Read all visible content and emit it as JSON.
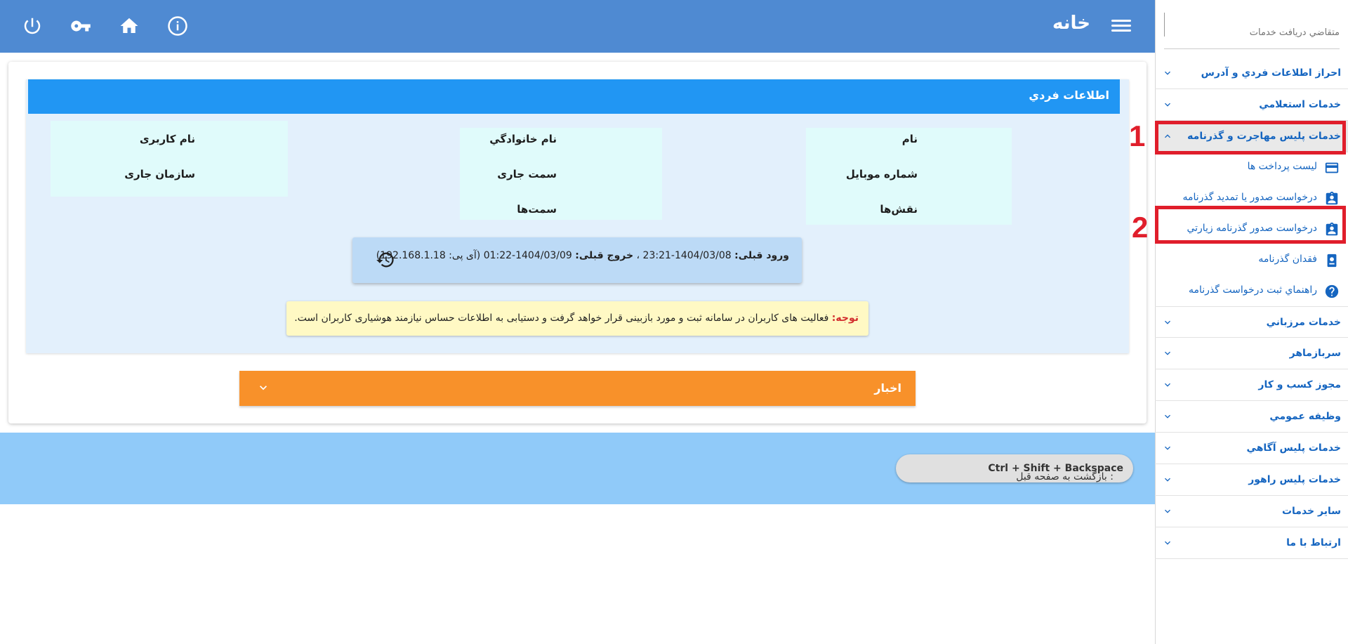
{
  "header": {
    "title": "خانه"
  },
  "personal_info": {
    "title": "اطلاعات فردي",
    "labels": {
      "name": "نام",
      "family": "نام خانوادگي",
      "username": "نام کاربری",
      "mobile": "شماره موبايل",
      "position": "سمت جاری",
      "organization": "سازمان جاری",
      "roles": "نقش‌ها",
      "positions": "سمت‌ها"
    }
  },
  "login": {
    "prev_login_label": "ورود قبلی:",
    "prev_login_value": "1404/03/08-23:21",
    "sep": "،",
    "prev_logout_label": "خروج قبلی:",
    "prev_logout_value": "1404/03/09-01:22",
    "ip_text": "(آی پی: 192.168.1.18)"
  },
  "notice": {
    "warn": "توجه:",
    "text": "فعالیت های کاربران در سامانه ثبت و مورد بازبینی قرار خواهد گرفت و دستیابی به اطلاعات حساس نیازمند هوشیاری کاربران است."
  },
  "news": {
    "label": "اخبار"
  },
  "footer": {
    "shortcut": "Ctrl + Shift + Backspace",
    "shortcut_desc": ": بازگشت به صفحه قبل"
  },
  "sidebar": {
    "search_placeholder": "متقاضي دريافت خدمات",
    "items": [
      {
        "label": "احراز اطلاعات فردي و آدرس"
      },
      {
        "label": "خدمات استعلامي"
      },
      {
        "label": "خدمات پليس مهاجرت و گذرنامه"
      },
      {
        "label": "خدمات مرزباني"
      },
      {
        "label": "سربازماهر"
      },
      {
        "label": "مجوز کسب و کار"
      },
      {
        "label": "وظيفه عمومي"
      },
      {
        "label": "خدمات پليس آگاهي"
      },
      {
        "label": "خدمات پليس راهور"
      },
      {
        "label": "ساير خدمات"
      },
      {
        "label": "ارتباط با ما"
      }
    ],
    "subitems": [
      {
        "label": "ليست پرداخت ها",
        "icon": "credit-card-icon"
      },
      {
        "label": "درخواست صدور يا تمديد گذرنامه",
        "icon": "id-badge-icon"
      },
      {
        "label": "درخواست صدور گذرنامه زيارتي",
        "icon": "id-badge-icon"
      },
      {
        "label": "فقدان گذرنامه",
        "icon": "lost-passport-icon"
      },
      {
        "label": "راهنماي ثبت درخواست گذرنامه",
        "icon": "help-circle-icon"
      }
    ]
  },
  "annotations": {
    "marker1": "1",
    "marker2": "2"
  },
  "colors": {
    "topbar": "#4f8ad2",
    "panel_header": "#2196f3",
    "news": "#f8912a",
    "footer": "#90caf9",
    "highlight": "#e01e2b",
    "link": "#1565c0"
  }
}
